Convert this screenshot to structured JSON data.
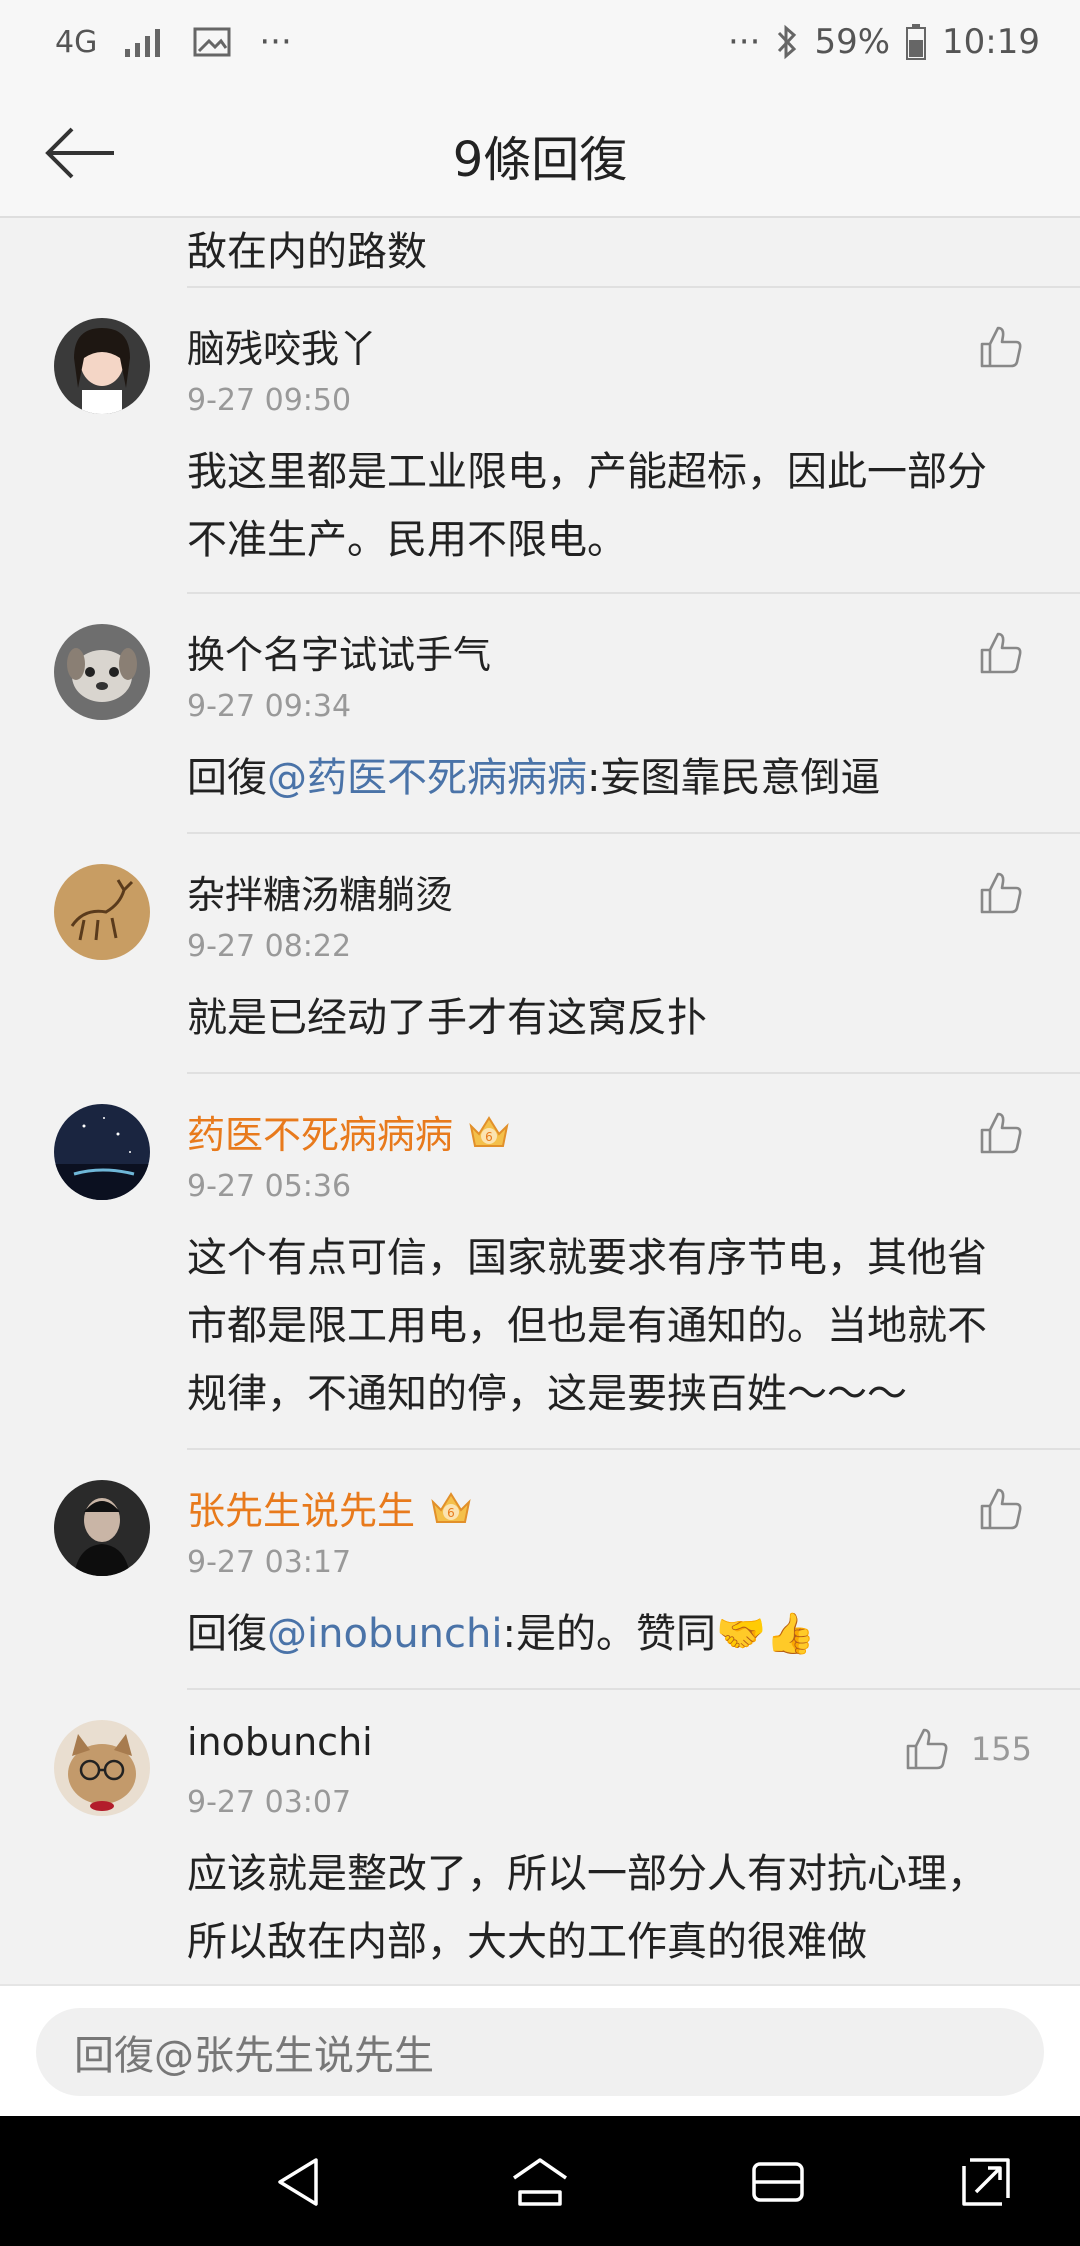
{
  "status_bar": {
    "network": "4G",
    "battery": "59%",
    "time": "10:19"
  },
  "header": {
    "title": "9條回復"
  },
  "partial_comment": {
    "text": "敌在内的路数"
  },
  "comments": [
    {
      "name": "脑残咬我丫",
      "time": "9-27 09:50",
      "lines": [
        "我这里都是工业限电，产能超标，因此一部分",
        "不准生产。民用不限电。"
      ]
    },
    {
      "name": "换个名字试试手气",
      "time": "9-27 09:34",
      "prefix": "回復",
      "mention": "@药医不死病病病",
      "text": ":妄图靠民意倒逼"
    },
    {
      "name": "杂拌糖汤糖躺烫",
      "time": "9-27 08:22",
      "text": "就是已经动了手才有这窝反扑"
    },
    {
      "name": "药医不死病病病",
      "badge": "6",
      "time": "9-27 05:36",
      "lines": [
        "这个有点可信，国家就要求有序节电，其他省",
        "市都是限工用电，但也是有通知的。当地就不",
        "规律，不通知的停，这是要挟百姓～～～"
      ]
    },
    {
      "name": "张先生说先生",
      "badge": "6",
      "time": "9-27 03:17",
      "prefix": "回復",
      "mention": "@inobunchi",
      "text": ":是的。赞同🤝👍"
    },
    {
      "name": "inobunchi",
      "time": "9-27 03:07",
      "likes": "155",
      "lines": [
        "应该就是整改了，所以一部分人有对抗心理，",
        "所以敌在内部，大大的工作真的很难做"
      ]
    }
  ],
  "reply_bar": {
    "placeholder": "回復@张先生说先生"
  },
  "colors": {
    "vip_name": "#e87a1c",
    "mention": "#4a73a8",
    "meta": "#999999"
  }
}
